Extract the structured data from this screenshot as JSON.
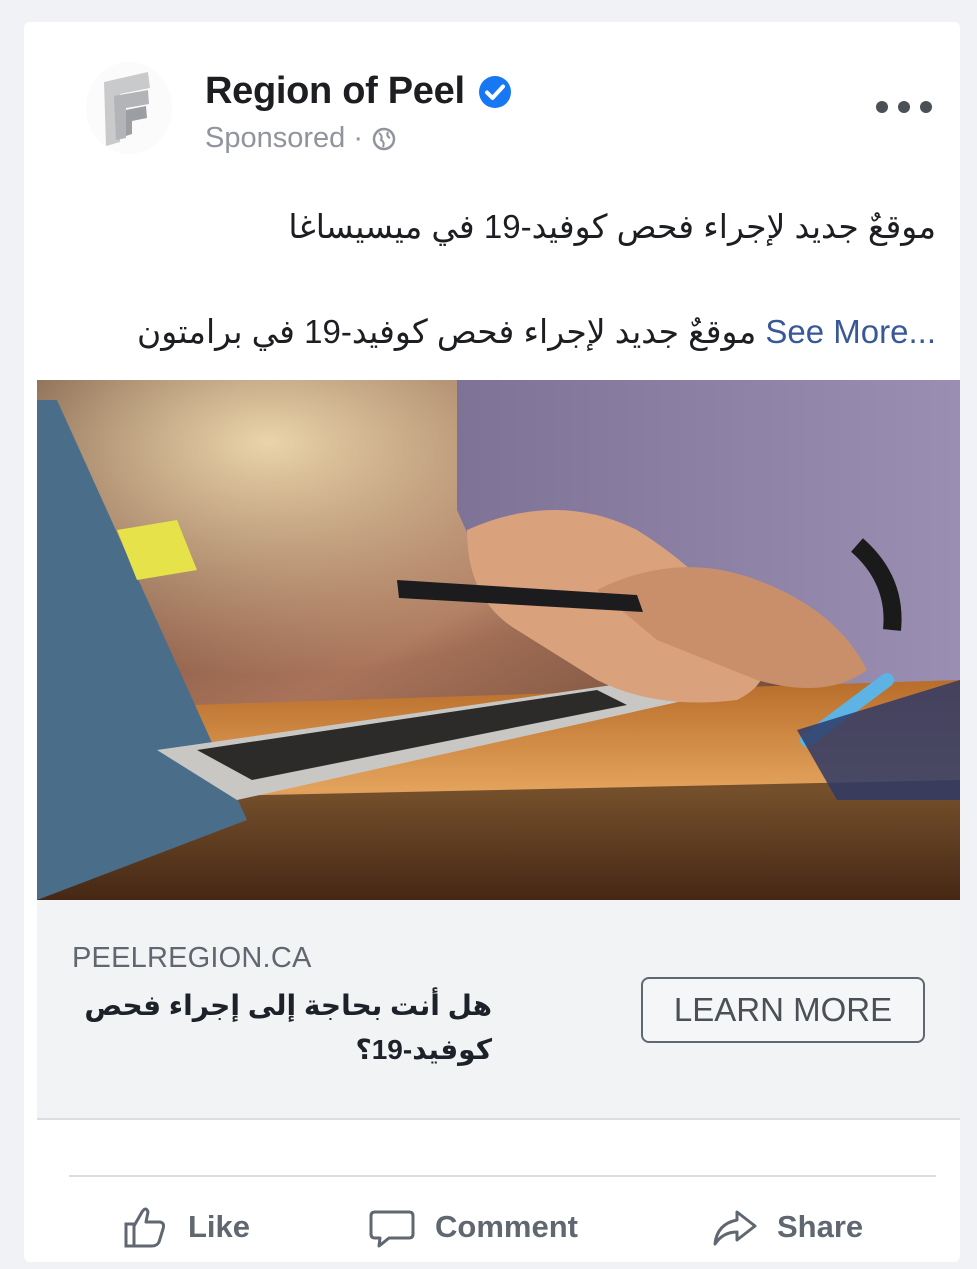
{
  "post": {
    "page_name": "Region of Peel",
    "sponsored_label": "Sponsored ·",
    "text_line1": "موقعٌ جديد لإجراء فحص كوفيد-19 في ميسيساغا",
    "text_line2": "موقعٌ جديد لإجراء فحص كوفيد-19 في برامتون",
    "see_more": "See More..."
  },
  "link_preview": {
    "domain": "PEELREGION.CA",
    "headline": "هل أنت بحاجة إلى إجراء فحص كوفيد-19؟",
    "cta_label": "LEARN MORE"
  },
  "actions": {
    "like": "Like",
    "comment": "Comment",
    "share": "Share"
  },
  "icons": {
    "verified": "verified-badge-icon",
    "privacy": "globe-icon",
    "more": "more-options-icon",
    "like": "thumbs-up-icon",
    "comment": "comment-bubble-icon",
    "share": "share-arrow-icon"
  },
  "colors": {
    "verified_blue": "#1877f2",
    "link_blue": "#385898",
    "muted_text": "#606770"
  }
}
